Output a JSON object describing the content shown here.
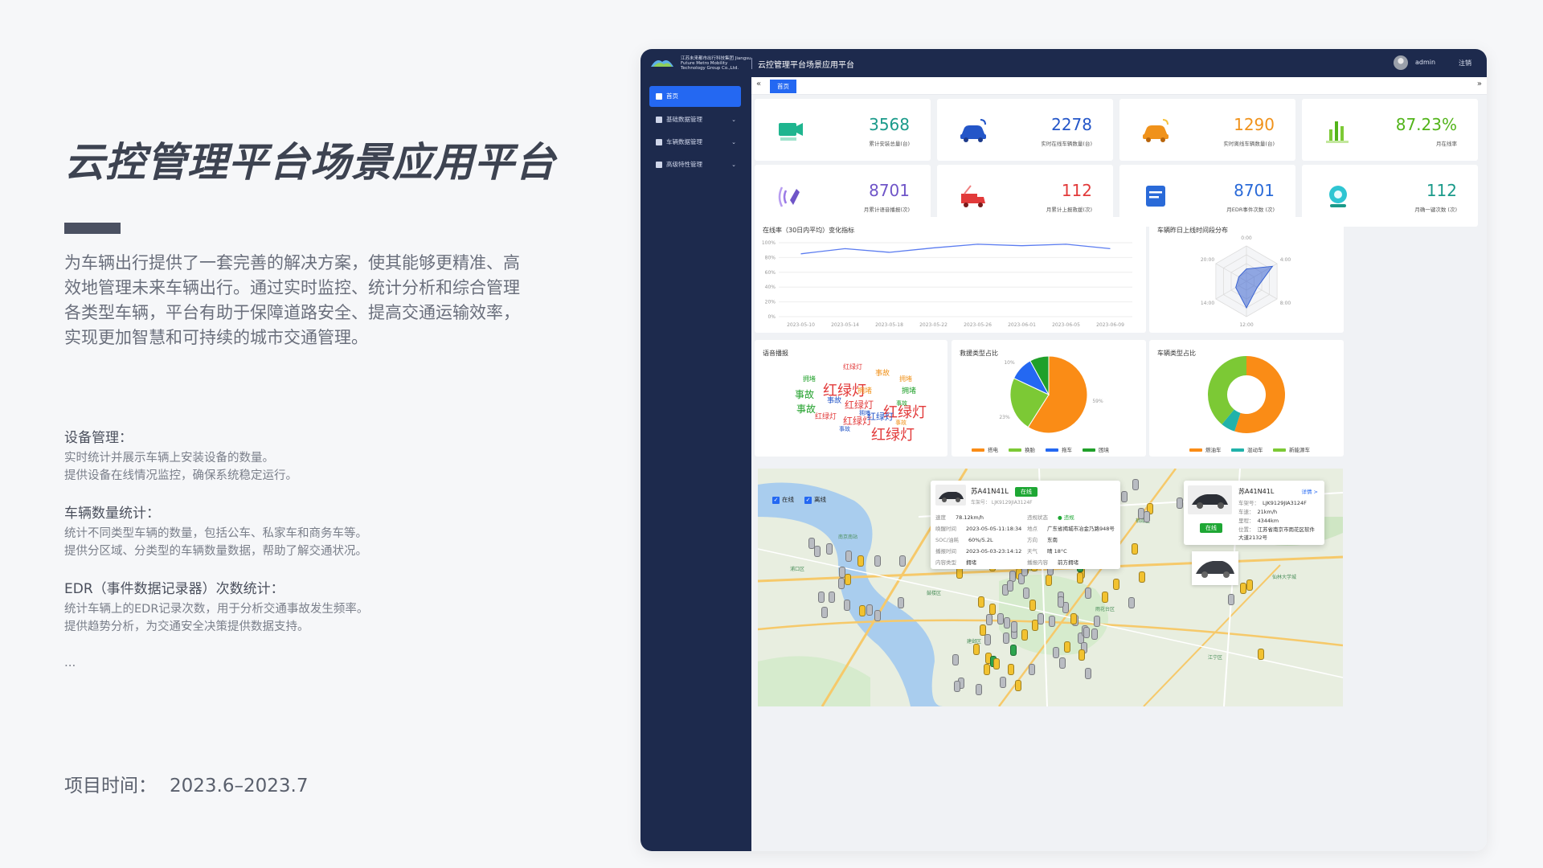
{
  "left": {
    "title": "云控管理平台场景应用平台",
    "intro": "为车辆出行提供了一套完善的解决方案，使其能够更精准、高效地管理未来车辆出行。通过实时监控、统计分析和综合管理各类型车辆，平台有助于保障道路安全、提高交通运输效率，实现更加智慧和可持续的城市交通管理。",
    "features": [
      {
        "heading": "设备管理：",
        "lines": [
          "实时统计并展示车辆上安装设备的数量。",
          "提供设备在线情况监控，确保系统稳定运行。"
        ]
      },
      {
        "heading": "车辆数量统计：",
        "lines": [
          "统计不同类型车辆的数量，包括公车、私家车和商务车等。",
          "提供分区域、分类型的车辆数量数据，帮助了解交通状况。"
        ]
      },
      {
        "heading": "EDR（事件数据记录器）次数统计：",
        "lines": [
          "统计车辆上的EDR记录次数，用于分析交通事故发生频率。",
          "提供趋势分析，为交通安全决策提供数据支持。"
        ]
      }
    ],
    "ellipsis": "...",
    "project_time_label": "项目时间：",
    "project_time": "2023.6–2023.7"
  },
  "app": {
    "logo_text": "江苏未来都市出行科技集团 Jiangsu Future Metro Mobility Technology Group Co.,Ltd.",
    "title": "云控管理平台场景应用平台",
    "user": "admin",
    "logout": "注销",
    "nav": [
      {
        "label": "首页",
        "active": true
      },
      {
        "label": "基础数据管理"
      },
      {
        "label": "车辆数据管理"
      },
      {
        "label": "高级特性管理"
      }
    ],
    "tab_home": "首页",
    "tab_prev": "«",
    "tab_next": "»"
  },
  "stats": [
    {
      "value": "3568",
      "label": "累计安装总量(台)",
      "color": "#1a9a8a",
      "icon": "camera-icon"
    },
    {
      "value": "2278",
      "label": "实时在线车辆数量(台)",
      "color": "#2456c8",
      "icon": "connected-car-icon"
    },
    {
      "value": "1290",
      "label": "实时离线车辆数量(台)",
      "color": "#f0921b",
      "icon": "offline-car-icon"
    },
    {
      "value": "87.23%",
      "label": "月在线率",
      "color": "#52b41a",
      "icon": "bar-chart-icon"
    },
    {
      "value": "8701",
      "label": "月累计语音播报(次)",
      "color": "#6f55c8",
      "icon": "voice-icon"
    },
    {
      "value": "112",
      "label": "月累计上报救援(次)",
      "color": "#e23a3a",
      "icon": "tow-truck-icon"
    },
    {
      "value": "8701",
      "label": "月EDR事件次数 (次)",
      "color": "#2a6ad8",
      "icon": "edr-doc-icon"
    },
    {
      "value": "112",
      "label": "月确一键次数 (次)",
      "color": "#1a9a8a",
      "icon": "sos-button-icon"
    }
  ],
  "colors": {
    "accent": "#2468f2",
    "sidebar": "#1d2a4d",
    "orange": "#fa8c16",
    "green": "#7cc935",
    "blue": "#2468f2",
    "dark_green": "#20a02a",
    "teal": "#20b2aa"
  },
  "chart_data": [
    {
      "type": "line",
      "title": "在线率（30日内平均）变化指标",
      "x": [
        "2023-05-10",
        "2023-05-14",
        "2023-05-18",
        "2023-05-22",
        "2023-05-26",
        "2023-06-01",
        "2023-06-05",
        "2023-06-09"
      ],
      "values": [
        85,
        92,
        87,
        93,
        98,
        96,
        98,
        92
      ],
      "ylim": [
        0,
        100
      ],
      "yticks": [
        "100%",
        "80%",
        "60%",
        "40%",
        "20%",
        "0%"
      ],
      "grid": true
    },
    {
      "type": "radar",
      "title": "车辆昨日上线时间段分布",
      "axes": [
        "0:00",
        "4:00",
        "8:00",
        "12:00",
        "14:00",
        "20:00"
      ],
      "values": [
        0.35,
        0.85,
        0.35,
        0.75,
        0.35,
        0.25
      ]
    },
    {
      "type": "wordcloud",
      "title": "语音播报",
      "words": [
        {
          "text": "红绿灯",
          "size": 8,
          "color": "#e23a3a"
        },
        {
          "text": "拥堵",
          "size": 8,
          "color": "#20a02a"
        },
        {
          "text": "红绿灯",
          "size": 18,
          "color": "#e23a3a"
        },
        {
          "text": "事故",
          "size": 12,
          "color": "#20a02a"
        },
        {
          "text": "事故",
          "size": 12,
          "color": "#20a02a"
        },
        {
          "text": "红绿灯",
          "size": 12,
          "color": "#e23a3a"
        },
        {
          "text": "红绿灯",
          "size": 18,
          "color": "#e23a3a"
        },
        {
          "text": "红绿灯",
          "size": 12,
          "color": "#e23a3a"
        },
        {
          "text": "红绿灯",
          "size": 11,
          "color": "#2456c8"
        },
        {
          "text": "红绿灯",
          "size": 18,
          "color": "#e23a3a"
        },
        {
          "text": "事故",
          "size": 9,
          "color": "#f0921b"
        },
        {
          "text": "拥堵",
          "size": 9,
          "color": "#20a02a"
        },
        {
          "text": "事故",
          "size": 9,
          "color": "#2456c8"
        },
        {
          "text": "拥堵",
          "size": 8,
          "color": "#f0921b"
        },
        {
          "text": "事故",
          "size": 7,
          "color": "#20a02a"
        },
        {
          "text": "拥堵",
          "size": 9,
          "color": "#f0921b"
        },
        {
          "text": "红绿灯",
          "size": 9,
          "color": "#e23a3a"
        },
        {
          "text": "事故",
          "size": 7,
          "color": "#f0921b"
        },
        {
          "text": "拥堵",
          "size": 7,
          "color": "#2456c8"
        },
        {
          "text": "事故",
          "size": 7,
          "color": "#2456c8"
        }
      ]
    },
    {
      "type": "pie",
      "title": "救援类型占比",
      "series": [
        {
          "name": "搭电",
          "value": 59,
          "color": "#fa8c16"
        },
        {
          "name": "换胎",
          "value": 23,
          "color": "#7cc935"
        },
        {
          "name": "拖车",
          "value": 10,
          "color": "#2468f2"
        },
        {
          "name": "困境",
          "value": 8,
          "color": "#20a02a"
        }
      ],
      "labels": [
        "10%",
        "59%",
        "23%"
      ],
      "legend": "bottom"
    },
    {
      "type": "donut",
      "title": "车辆类型占比",
      "series": [
        {
          "name": "燃油车",
          "value": 55,
          "color": "#fa8c16"
        },
        {
          "name": "混动车",
          "value": 6,
          "color": "#20b2aa"
        },
        {
          "name": "新能源车",
          "value": 39,
          "color": "#7cc935"
        }
      ],
      "legend": "bottom"
    }
  ],
  "map": {
    "filters": [
      {
        "label": "在线"
      },
      {
        "label": "离线"
      }
    ],
    "popup1": {
      "plate": "苏A41N41L",
      "status": "在线",
      "vin": "车架号： LJK9129JIA3124F",
      "rows": [
        [
          "速度",
          "78.12km/h",
          "违规状态",
          "● 违规"
        ],
        [
          "唤醒时间",
          "2023-05-05-11:18:34",
          "地点",
          "广东省揭城市冶金乃路948号"
        ],
        [
          "SOC/油耗",
          "60%/5.2L",
          "方向",
          "东南"
        ],
        [
          "播报时间",
          "2023-05-03-23:14:12",
          "天气",
          "晴  18°C"
        ],
        [
          "内容类型",
          "拥堵",
          "播报内容",
          "前方拥堵"
        ]
      ]
    },
    "popup2": {
      "plate": "苏A41N41L",
      "detail": "详情 >",
      "status": "在线",
      "rows": [
        [
          "车架号：",
          "LJK9129JIA3124F"
        ],
        [
          "车速：",
          "21km/h"
        ],
        [
          "里程：",
          "4344km"
        ],
        [
          "位置：",
          "江苏省南京市雨花区软件大道2132号"
        ]
      ]
    },
    "labels": [
      "南京南站",
      "雨花台区",
      "江宁区",
      "浦口区",
      "栖霞区",
      "秦淮区",
      "建邺区",
      "鼓楼区",
      "玄武区",
      "仙林大学城"
    ]
  }
}
